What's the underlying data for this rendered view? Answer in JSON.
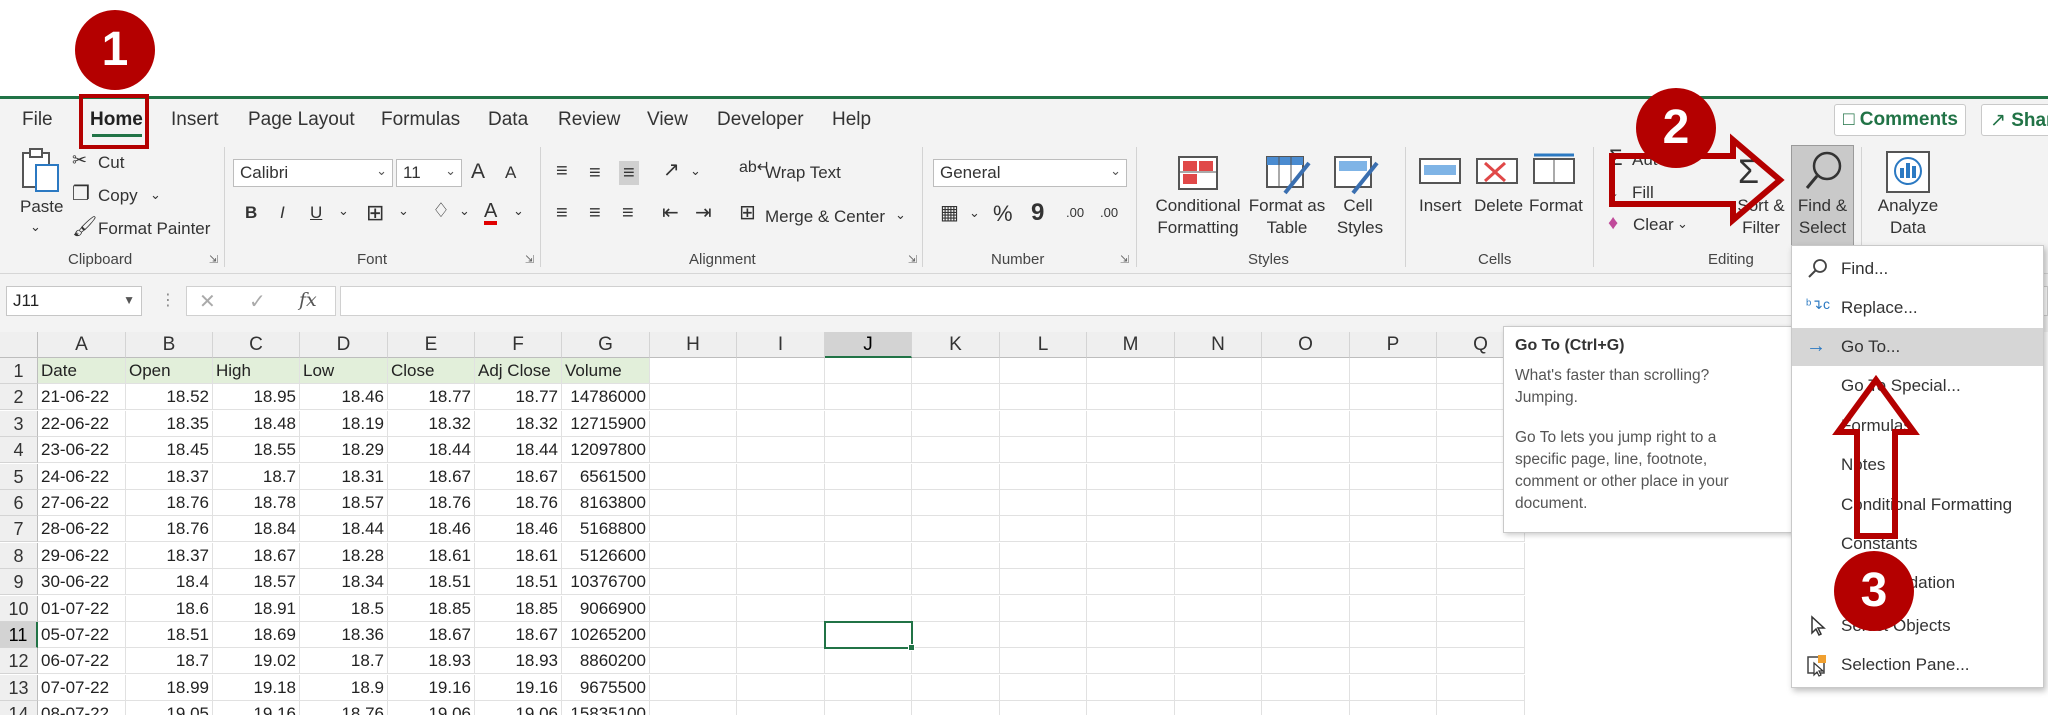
{
  "tabs": [
    "File",
    "Home",
    "Insert",
    "Page Layout",
    "Formulas",
    "Data",
    "Review",
    "View",
    "Developer",
    "Help"
  ],
  "comments_label": "Comments",
  "share_label": "Shar",
  "clipboard": {
    "paste": "Paste",
    "cut": "Cut",
    "copy": "Copy",
    "format_painter": "Format Painter",
    "group": "Clipboard"
  },
  "font": {
    "name": "Calibri",
    "size": "11",
    "bold": "B",
    "italic": "I",
    "underline": "U",
    "grow": "A",
    "shrink": "A",
    "font_color": "A",
    "group": "Font"
  },
  "alignment": {
    "wrap_text": "Wrap Text",
    "merge_center": "Merge & Center",
    "group": "Alignment"
  },
  "number": {
    "format": "General",
    "percent": "%",
    "comma": "9",
    "increase_decimal": ".00",
    "decrease_decimal": ".00",
    "group": "Number"
  },
  "styles": {
    "conditional_formatting_1": "Conditional",
    "conditional_formatting_2": "Formatting",
    "format_as_table_1": "Format as",
    "format_as_table_2": "Table",
    "cell_styles_1": "Cell",
    "cell_styles_2": "Styles",
    "group": "Styles"
  },
  "cells": {
    "insert": "Insert",
    "delete": "Delete",
    "format": "Format",
    "group": "Cells"
  },
  "editing": {
    "autosum": "Aut",
    "fill": "Fill",
    "clear": "Clear",
    "sort_filter_1": "Sort &",
    "sort_filter_2": "Filter",
    "find_select_1": "Find &",
    "find_select_2": "Select",
    "group": "Editing"
  },
  "analysis": {
    "analyze_1": "Analyze",
    "analyze_2": "Data"
  },
  "namebox": "J11",
  "fx": "fx",
  "columns": [
    "A",
    "B",
    "C",
    "D",
    "E",
    "F",
    "G",
    "H",
    "I",
    "J",
    "K",
    "L",
    "M",
    "N",
    "O",
    "P",
    "Q"
  ],
  "selected_column": "J",
  "selected_row": "11",
  "rows": [
    "1",
    "2",
    "3",
    "4",
    "5",
    "6",
    "7",
    "8",
    "9",
    "10",
    "11",
    "12",
    "13",
    "14"
  ],
  "headers": [
    "Date",
    "Open",
    "High",
    "Low",
    "Close",
    "Adj Close",
    "Volume"
  ],
  "data": [
    [
      "21-06-22",
      "18.52",
      "18.95",
      "18.46",
      "18.77",
      "18.77",
      "14786000"
    ],
    [
      "22-06-22",
      "18.35",
      "18.48",
      "18.19",
      "18.32",
      "18.32",
      "12715900"
    ],
    [
      "23-06-22",
      "18.45",
      "18.55",
      "18.29",
      "18.44",
      "18.44",
      "12097800"
    ],
    [
      "24-06-22",
      "18.37",
      "18.7",
      "18.31",
      "18.67",
      "18.67",
      "6561500"
    ],
    [
      "27-06-22",
      "18.76",
      "18.78",
      "18.57",
      "18.76",
      "18.76",
      "8163800"
    ],
    [
      "28-06-22",
      "18.76",
      "18.84",
      "18.44",
      "18.46",
      "18.46",
      "5168800"
    ],
    [
      "29-06-22",
      "18.37",
      "18.67",
      "18.28",
      "18.61",
      "18.61",
      "5126600"
    ],
    [
      "30-06-22",
      "18.4",
      "18.57",
      "18.34",
      "18.51",
      "18.51",
      "10376700"
    ],
    [
      "01-07-22",
      "18.6",
      "18.91",
      "18.5",
      "18.85",
      "18.85",
      "9066900"
    ],
    [
      "05-07-22",
      "18.51",
      "18.69",
      "18.36",
      "18.67",
      "18.67",
      "10265200"
    ],
    [
      "06-07-22",
      "18.7",
      "19.02",
      "18.7",
      "18.93",
      "18.93",
      "8860200"
    ],
    [
      "07-07-22",
      "18.99",
      "19.18",
      "18.9",
      "19.16",
      "19.16",
      "9675500"
    ],
    [
      "08-07-22",
      "19.05",
      "19.16",
      "18.76",
      "19.06",
      "19.06",
      "15835100"
    ]
  ],
  "tooltip": {
    "title": "Go To (Ctrl+G)",
    "line1": "What's faster than scrolling?",
    "line2": "Jumping.",
    "line3": "Go To lets you jump right to a",
    "line4": "specific page, line, footnote,",
    "line5": "comment or other place in your",
    "line6": "document."
  },
  "dropdown": [
    "Find...",
    "Replace...",
    "Go To...",
    "Go To Special...",
    "Formulas",
    "Notes",
    "Conditional Formatting",
    "Constants",
    "Data Validation",
    "Select Objects",
    "Selection Pane..."
  ],
  "annotations": [
    "1",
    "2",
    "3"
  ],
  "colors": {
    "accent": "#217346",
    "annotation": "#b40000",
    "header_fill": "#e2efda"
  }
}
